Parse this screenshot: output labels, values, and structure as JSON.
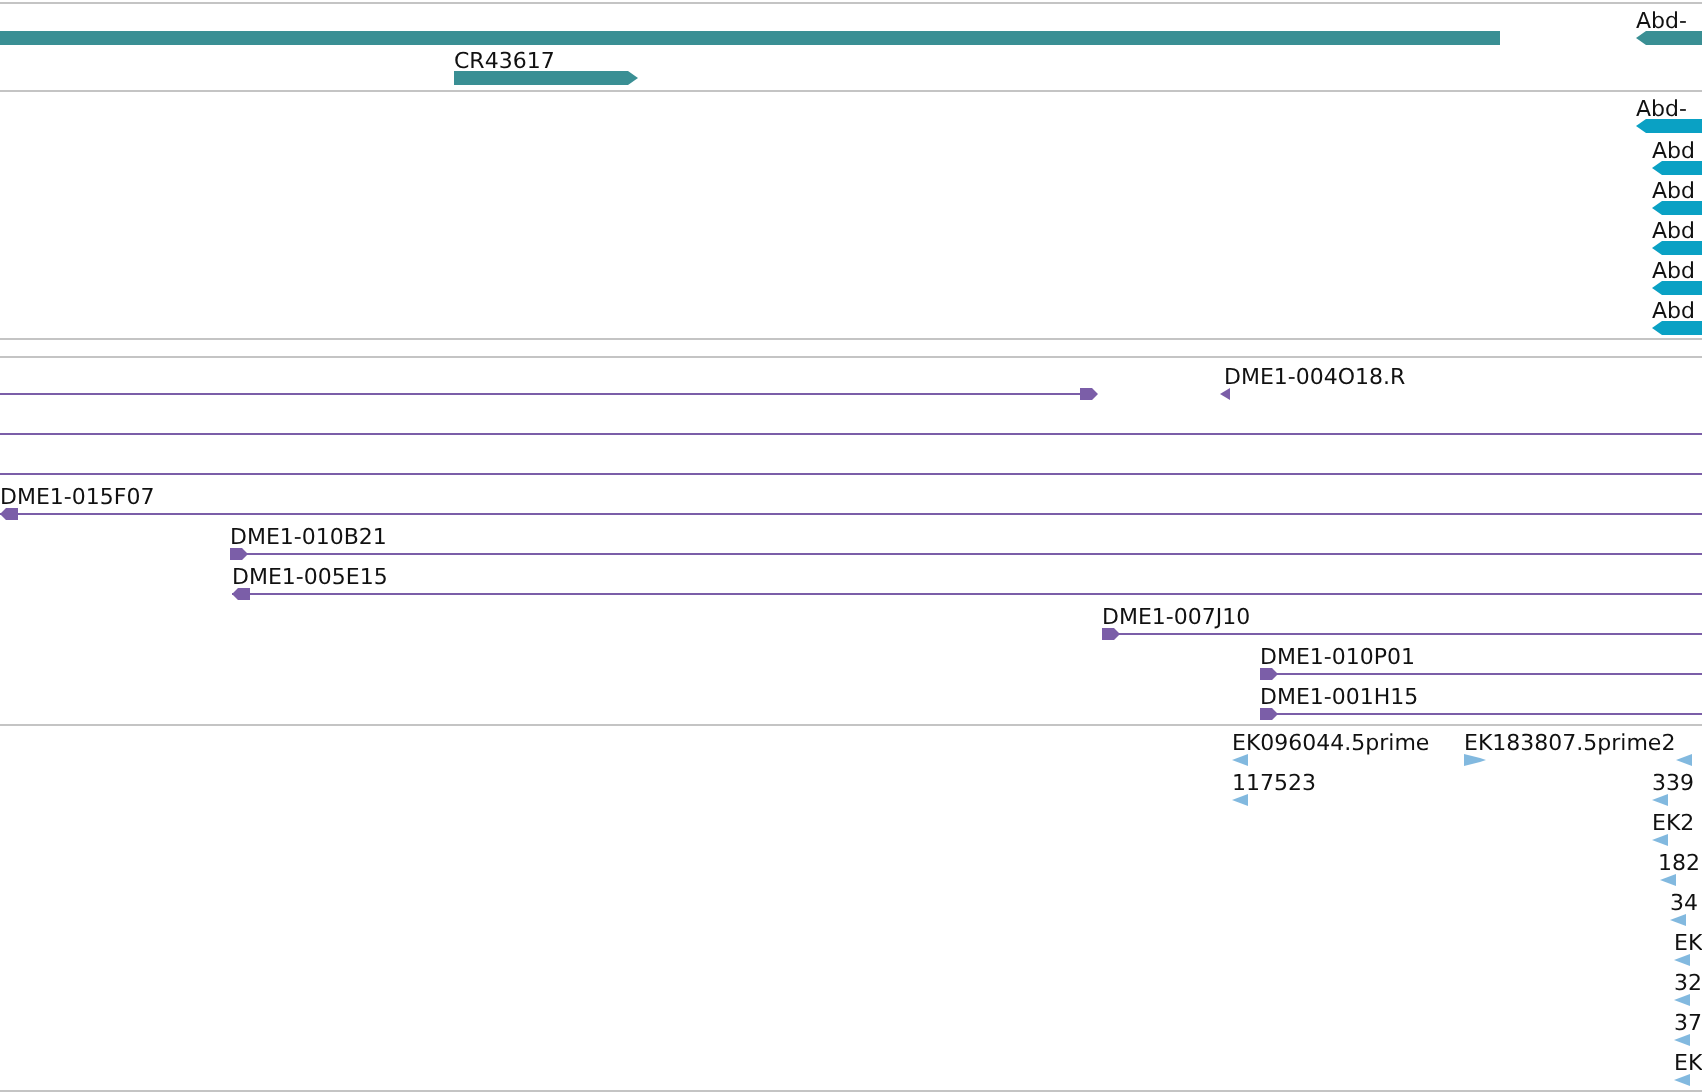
{
  "tracks": [
    {
      "kind": "gene",
      "color": "#3a8f94",
      "features": [
        {
          "kind": "plain"
        },
        {
          "label": "Abd-",
          "kind": "reverse"
        },
        {
          "label": "CR43617",
          "kind": "forward"
        }
      ]
    },
    {
      "kind": "gene",
      "color": "#0aa1c4",
      "features": [
        {
          "label": "Abd-",
          "kind": "reverse"
        },
        {
          "label": "Abd",
          "kind": "reverse"
        },
        {
          "label": "Abd",
          "kind": "reverse"
        },
        {
          "label": "Abd",
          "kind": "reverse"
        },
        {
          "label": "Abd",
          "kind": "reverse"
        },
        {
          "label": "Abd",
          "kind": "reverse"
        }
      ]
    },
    {
      "kind": "clone",
      "color": "#7b5ea8",
      "features": [
        {
          "kind": "forward"
        },
        {
          "label": "DME1-004O18.R",
          "kind": "reverse"
        },
        {
          "kind": "plain"
        },
        {
          "kind": "plain"
        },
        {
          "label": "DME1-015F07",
          "kind": "reverse"
        },
        {
          "label": "DME1-010B21",
          "kind": "forward"
        },
        {
          "label": "DME1-005E15",
          "kind": "reverse"
        },
        {
          "label": "DME1-007J10",
          "kind": "forward"
        },
        {
          "label": "DME1-010P01",
          "kind": "forward"
        },
        {
          "label": "DME1-001H15",
          "kind": "forward"
        }
      ]
    },
    {
      "kind": "est",
      "color": "#82b9df",
      "features": [
        {
          "label": "EK096044.5prime",
          "kind": "reverse"
        },
        {
          "label": "EK183807.5prime2",
          "kind": "forward"
        },
        {
          "kind": "reverse"
        },
        {
          "label": "117523",
          "kind": "reverse"
        },
        {
          "label": "339",
          "kind": "reverse"
        },
        {
          "label": "EK2",
          "kind": "reverse"
        },
        {
          "label": "182",
          "kind": "reverse"
        },
        {
          "label": "34",
          "kind": "reverse"
        },
        {
          "label": "EK",
          "kind": "reverse"
        },
        {
          "label": "32",
          "kind": "reverse"
        },
        {
          "label": "37",
          "kind": "reverse"
        },
        {
          "label": "EK",
          "kind": "reverse"
        }
      ]
    }
  ]
}
